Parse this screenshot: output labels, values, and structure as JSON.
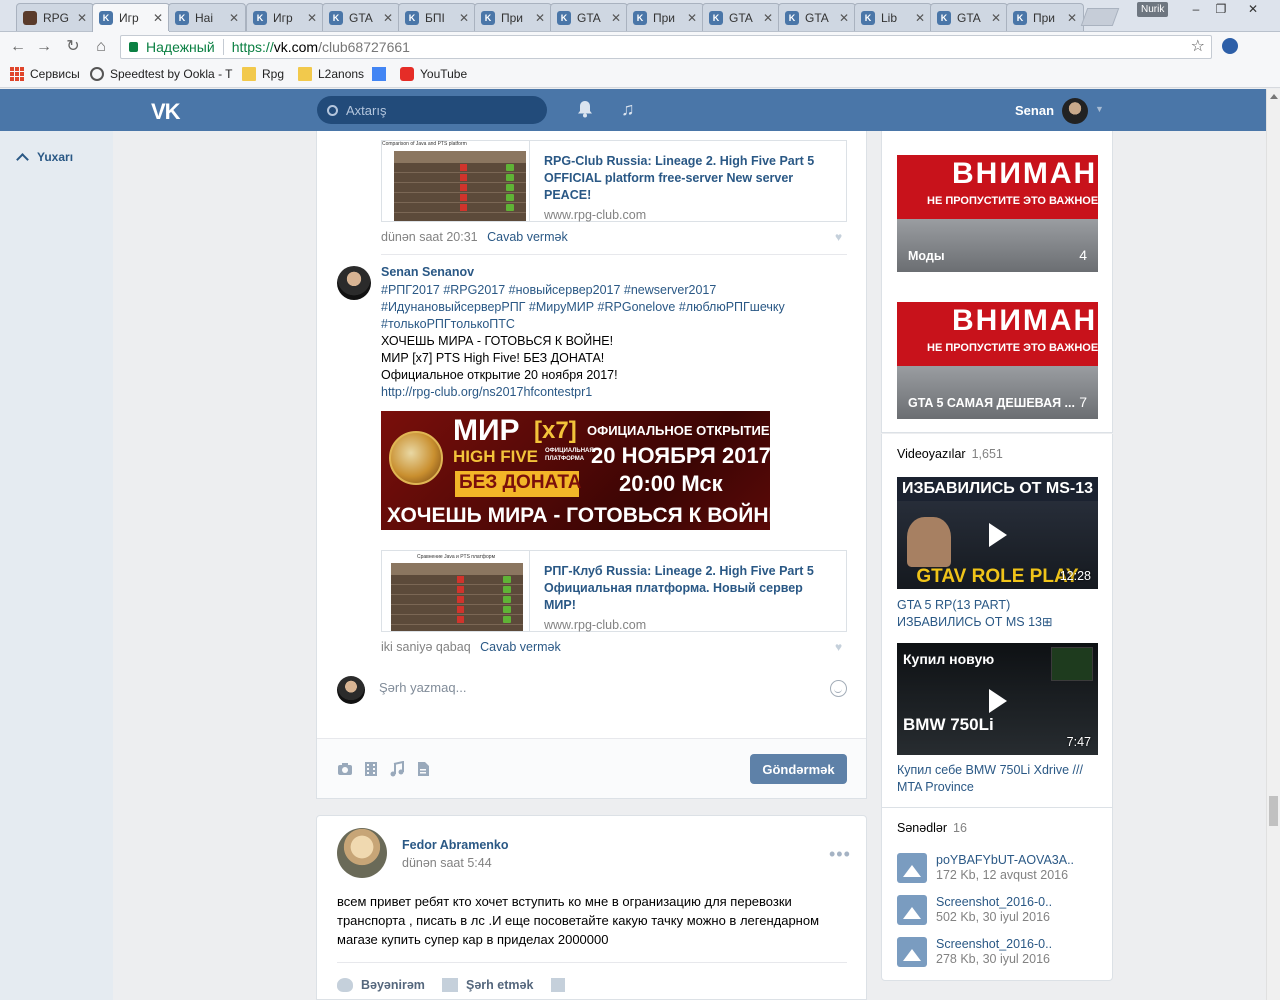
{
  "browser": {
    "tabs": [
      {
        "title": "RPG",
        "icon": "game-icon"
      },
      {
        "title": "Игр",
        "icon": "vk-icon",
        "active": true
      },
      {
        "title": "Наі",
        "icon": "vk-icon"
      },
      {
        "title": "Игр",
        "icon": "vk-icon"
      },
      {
        "title": "GTA",
        "icon": "vk-icon"
      },
      {
        "title": "БПІ",
        "icon": "vk-icon"
      },
      {
        "title": "При",
        "icon": "vk-icon"
      },
      {
        "title": "GTA",
        "icon": "vk-icon"
      },
      {
        "title": "При",
        "icon": "vk-icon"
      },
      {
        "title": "GTA",
        "icon": "vk-icon"
      },
      {
        "title": "GTA",
        "icon": "vk-icon"
      },
      {
        "title": "Lib",
        "icon": "vk-icon"
      },
      {
        "title": "GTA",
        "icon": "vk-icon"
      },
      {
        "title": "При",
        "icon": "vk-icon"
      }
    ],
    "profile_chip": "Nurik",
    "secure_label": "Надежный",
    "url_scheme": "https://",
    "url_host": "vk.com",
    "url_path": "/club68727661",
    "bookmarks": [
      "Сервисы",
      "Speedtest by Ookla - T",
      "Rpg",
      "L2anons",
      "YouTube"
    ]
  },
  "vk": {
    "search_placeholder": "Axtarış",
    "user_name": "Senan",
    "back_to_top": "Yuxarı",
    "accent_color": "#4a76a8"
  },
  "wall": {
    "snippet1": {
      "title": "RPG-Club Russia: Lineage 2. High Five Part 5 OFFICIAL platform free-server New server PEACE!",
      "domain": "www.rpg-club.com",
      "thumb_caption": "Comparison of Java and PTS platform"
    },
    "comment1_time": "dünən saat 20:31",
    "reply_label": "Cavab vermək",
    "comment2": {
      "author": "Senan Senanov",
      "hashtags": "#РПГ2017 #RPG2017 #новыйсервер2017 #newserver2017 #ИдунановыйсерверРПГ #МируМИР #RPGonelove #люблюРПГшечку #толькоРПГтолькоПТС",
      "line1": "ХОЧЕШЬ МИРА - ГОТОВЬСЯ К ВОЙНЕ!",
      "line2": "МИР [x7] PTS High Five! БЕЗ ДОНАТА!",
      "line3": "Официальное открытие 20 ноября 2017!",
      "link": "http://rpg-club.org/ns2017hfcontestpr1",
      "banner": {
        "mir": "МИР",
        "x7": "[x7]",
        "high_five": "HIGH FIVE",
        "official_platform": "ОФИЦИАЛЬНАЯ ПЛАТФОРМА",
        "no_donate": "БЕЗ ДОНАТА",
        "official_opening": "ОФИЦИАЛЬНОЕ ОТКРЫТИЕ",
        "date": "20 НОЯБРЯ 2017",
        "time": "20:00 Мск",
        "slogan": "ХОЧЕШЬ МИРА - ГОТОВЬСЯ К ВОЙНЕ"
      },
      "snippet": {
        "title": "РПГ-Клуб Russia: Lineage 2. High Five Part 5 Официальная платформа. Новый сервер МИР!",
        "domain": "www.rpg-club.com",
        "thumb_caption": "Сравнение Java и PTS платформ"
      },
      "time": "iki saniyə qabaq"
    },
    "comment_placeholder": "Şərh yazmaq...",
    "send_label": "Göndərmək"
  },
  "post2": {
    "author": "Fedor Abramenko",
    "time": "dünən saat 5:44",
    "text": "всем привет ребят кто хочет вступить ко мне в огранизацию для перевозки транспорта , писать в лс .И еще посоветайте какую тачку можно в легендарном магазе купить супер кар в приделах 2000000",
    "like_label": "Bəyənirəm",
    "comment_label": "Şərh etmək"
  },
  "sidebar": {
    "albums": [
      {
        "banner_big": "ВНИМАНИ",
        "banner_small": "НЕ ПРОПУСТИТЕ ЭТО ВАЖНОЕ",
        "title": "Моды",
        "count": "4"
      },
      {
        "banner_big": "ВНИМАНИ",
        "banner_small": "НЕ ПРОПУСТИТЕ ЭТО ВАЖНОЕ",
        "title": "GTA 5 САМАЯ ДЕШЕВАЯ ...",
        "count": "7"
      }
    ],
    "videos_label": "Videoyazılar",
    "videos_count": "1,651",
    "videos": [
      {
        "thumb_top": "ИЗБАВИЛИСЬ ОТ MS-13",
        "thumb_bottom": "GTAV ROLE PLAY",
        "duration": "12:28",
        "title": "GTA 5 RP(13 PART) ИЗБАВИЛИСЬ ОТ MS 13⊞"
      },
      {
        "thumb_top": "Купил новую",
        "thumb_bottom": "BMW 750Li",
        "duration": "7:47",
        "title": "Купил себе BMW 750Li Xdrive /// MTA Province"
      }
    ],
    "docs_label": "Sənədlər",
    "docs_count": "16",
    "docs": [
      {
        "name": "poYBAFYbUT-AOVA3A..",
        "meta": "172 Kb, 12 avqust 2016"
      },
      {
        "name": "Screenshot_2016-0..",
        "meta": "502 Kb, 30 iyul 2016"
      },
      {
        "name": "Screenshot_2016-0..",
        "meta": "278 Kb, 30 iyul 2016"
      }
    ]
  }
}
